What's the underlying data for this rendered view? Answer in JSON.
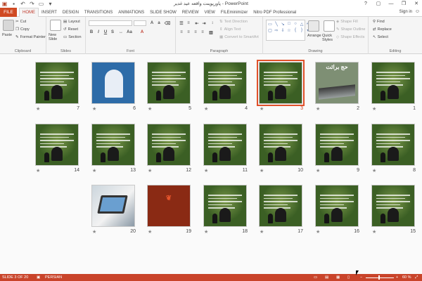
{
  "window": {
    "title": "پاورپوینت واقعه عید غدیر - PowerPoint",
    "help": "?"
  },
  "tabs": {
    "file": "FILE",
    "items": [
      "HOME",
      "INSERT",
      "DESIGN",
      "TRANSITIONS",
      "ANIMATIONS",
      "SLIDE SHOW",
      "REVIEW",
      "VIEW",
      "FILEminimizer",
      "Nitro PDF Professional"
    ],
    "sign_in": "Sign in"
  },
  "ribbon": {
    "clipboard": {
      "paste": "Paste",
      "cut": "Cut",
      "copy": "Copy",
      "format_painter": "Format Painter",
      "label": "Clipboard"
    },
    "slides": {
      "new_slide": "New Slide",
      "layout": "Layout",
      "reset": "Reset",
      "section": "Section",
      "label": "Slides"
    },
    "font": {
      "bold": "B",
      "italic": "I",
      "underline": "U",
      "strike": "S",
      "label": "Font"
    },
    "paragraph": {
      "text_direction": "Text Direction",
      "align_text": "Align Text",
      "convert_smartart": "Convert to SmartArt",
      "label": "Paragraph"
    },
    "drawing": {
      "arrange": "Arrange",
      "quick_styles": "Quick Styles",
      "shape_fill": "Shape Fill",
      "shape_outline": "Shape Outline",
      "shape_effects": "Shape Effects",
      "label": "Drawing"
    },
    "editing": {
      "find": "Find",
      "replace": "Replace",
      "select": "Select",
      "label": "Editing"
    }
  },
  "slides": [
    {
      "num": "1",
      "title": ""
    },
    {
      "num": "2",
      "title": "حج برائت"
    },
    {
      "num": "3",
      "title": ""
    },
    {
      "num": "4",
      "title": ""
    },
    {
      "num": "5",
      "title": ""
    },
    {
      "num": "6",
      "title": ""
    },
    {
      "num": "7",
      "title": ""
    },
    {
      "num": "8",
      "title": ""
    },
    {
      "num": "9",
      "title": ""
    },
    {
      "num": "10",
      "title": ""
    },
    {
      "num": "11",
      "title": ""
    },
    {
      "num": "12",
      "title": ""
    },
    {
      "num": "13",
      "title": ""
    },
    {
      "num": "14",
      "title": ""
    },
    {
      "num": "15",
      "title": ""
    },
    {
      "num": "16",
      "title": ""
    },
    {
      "num": "17",
      "title": ""
    },
    {
      "num": "18",
      "title": ""
    },
    {
      "num": "19",
      "title": ""
    },
    {
      "num": "20",
      "title": ""
    }
  ],
  "selected_slide": "3",
  "star": "★",
  "status": {
    "slide_info": "SLIDE 3 OF 20",
    "language": "PERSIAN",
    "zoom": "60 %"
  },
  "colors": {
    "accent": "#c9442a",
    "ribbon": "#f5f5f5",
    "slide_bg": "#3b5f24"
  }
}
